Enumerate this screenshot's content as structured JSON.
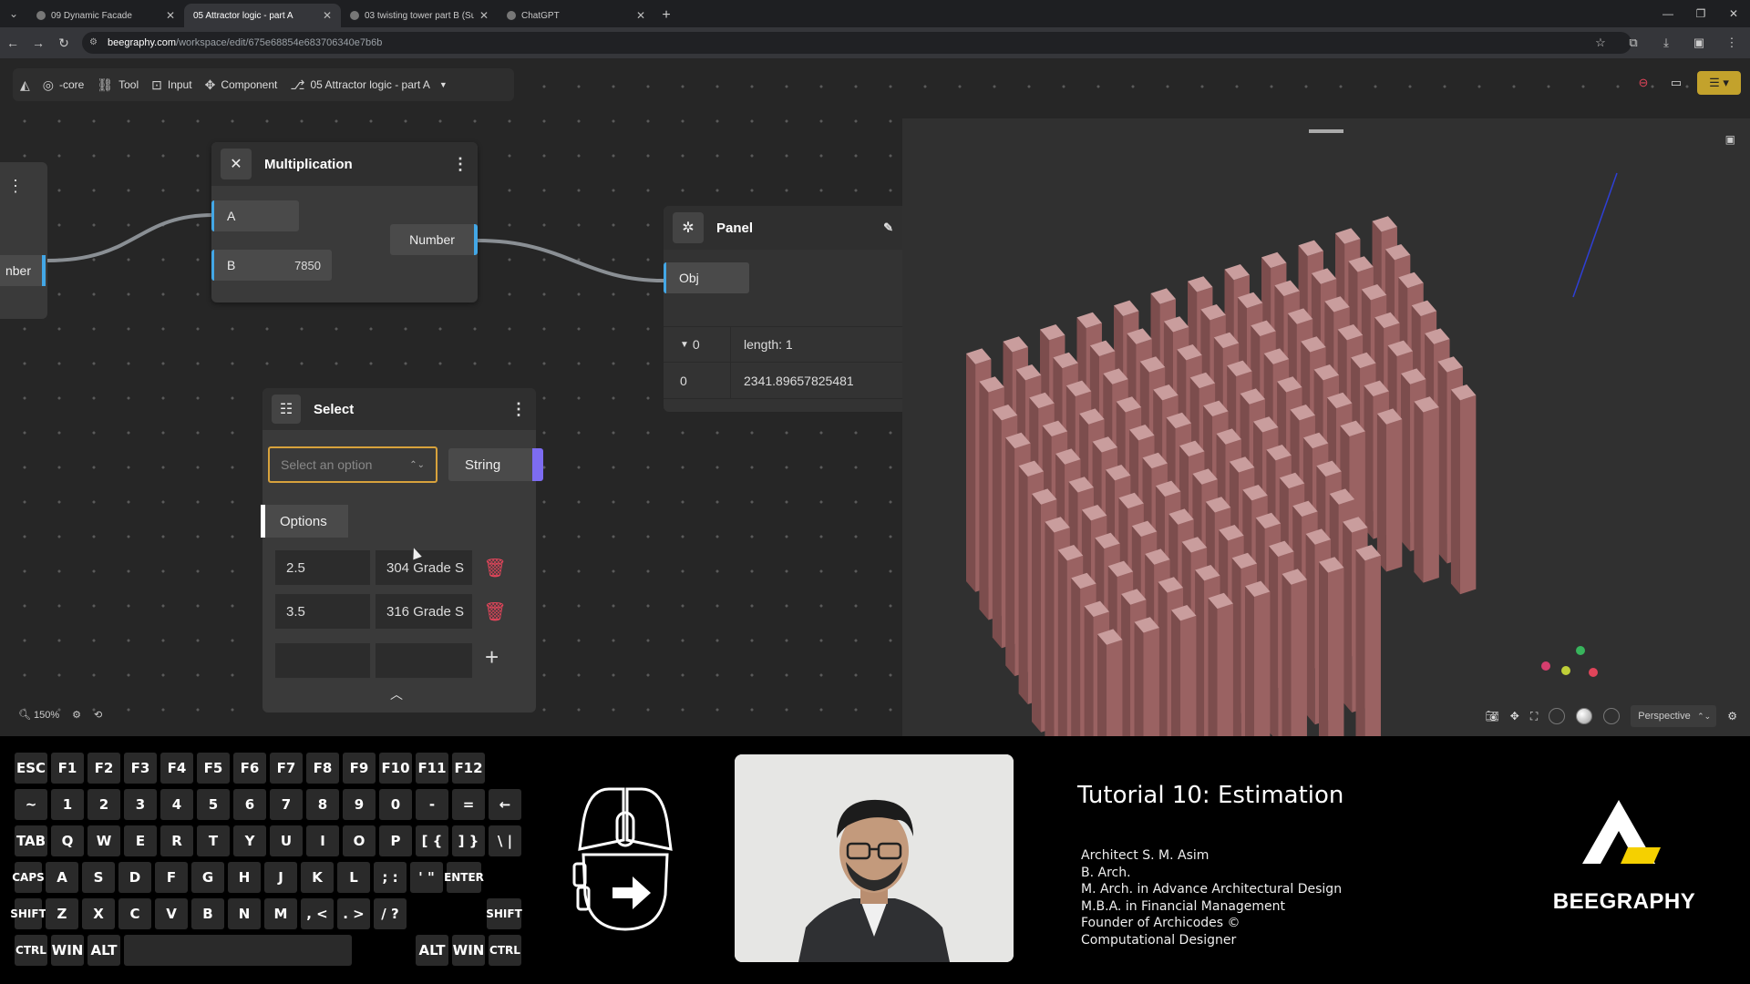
{
  "browser": {
    "tabs": [
      {
        "title": "09 Dynamic Facade",
        "active": false
      },
      {
        "title": "05 Attractor logic - part A",
        "active": true
      },
      {
        "title": "03 twisting tower part B (Surfac",
        "active": false
      },
      {
        "title": "ChatGPT",
        "active": false
      }
    ],
    "url_host": "beegraphy.com",
    "url_path": "/workspace/edit/675e68854e683706340e7b6b"
  },
  "toolbar": {
    "core_label": "-core",
    "tool_label": "Tool",
    "input_label": "Input",
    "component_label": "Component",
    "file_label": "05 Attractor logic - part A"
  },
  "left_node": {
    "out_label": "nber"
  },
  "multiplication": {
    "title": "Multiplication",
    "input_a": "A",
    "input_b": "B",
    "input_b_value": "7850",
    "output": "Number"
  },
  "panel": {
    "title": "Panel",
    "input": "Obj",
    "branch_index": "0",
    "branch_info": "length: 1",
    "row_index": "0",
    "row_value": "2341.89657825481"
  },
  "select": {
    "title": "Select",
    "placeholder": "Select an option",
    "output": "String",
    "options_label": "Options",
    "options": [
      {
        "value": "2.5",
        "label": "304 Grade S"
      },
      {
        "value": "3.5",
        "label": "316 Grade S"
      }
    ]
  },
  "zoom": {
    "level": "150%"
  },
  "viewer": {
    "projection": "Perspective"
  },
  "keyboard": {
    "rows": [
      [
        "ESC",
        "F1",
        "F2",
        "F3",
        "F4",
        "F5",
        "F6",
        "F7",
        "F8",
        "F9",
        "F10",
        "F11",
        "F12"
      ],
      [
        "~",
        "1",
        "2",
        "3",
        "4",
        "5",
        "6",
        "7",
        "8",
        "9",
        "0",
        "-",
        "=",
        "←"
      ],
      [
        "TAB",
        "Q",
        "W",
        "E",
        "R",
        "T",
        "Y",
        "U",
        "I",
        "O",
        "P",
        "[ {",
        "] }",
        "\\ |"
      ],
      [
        "CAPS",
        "A",
        "S",
        "D",
        "F",
        "G",
        "H",
        "J",
        "K",
        "L",
        "; :",
        "' \"",
        "ENTER"
      ],
      [
        "SHIFT",
        "Z",
        "X",
        "C",
        "V",
        "B",
        "N",
        "M",
        ", <",
        ". >",
        "/ ?",
        "SHIFT"
      ],
      [
        "CTRL",
        "WIN",
        "ALT",
        "",
        "ALT",
        "WIN",
        "CTRL"
      ]
    ]
  },
  "tutorial": {
    "title": "Tutorial 10: Estimation",
    "credits": [
      "Architect S. M. Asim",
      "B. Arch.",
      "M. Arch. in Advance Architectural Design",
      "M.B.A. in Financial Management",
      "Founder of Archicodes ©",
      "Computational Designer"
    ]
  },
  "brand": {
    "name": "BEEGRAPHY"
  },
  "colors": {
    "port_blue": "#43a7e6",
    "string_port": "#7d6cf2",
    "dropdown_focus": "#d8a23c",
    "trash_red": "#e0455a",
    "column": "#8a5555",
    "brand_yellow": "#f5d000"
  }
}
